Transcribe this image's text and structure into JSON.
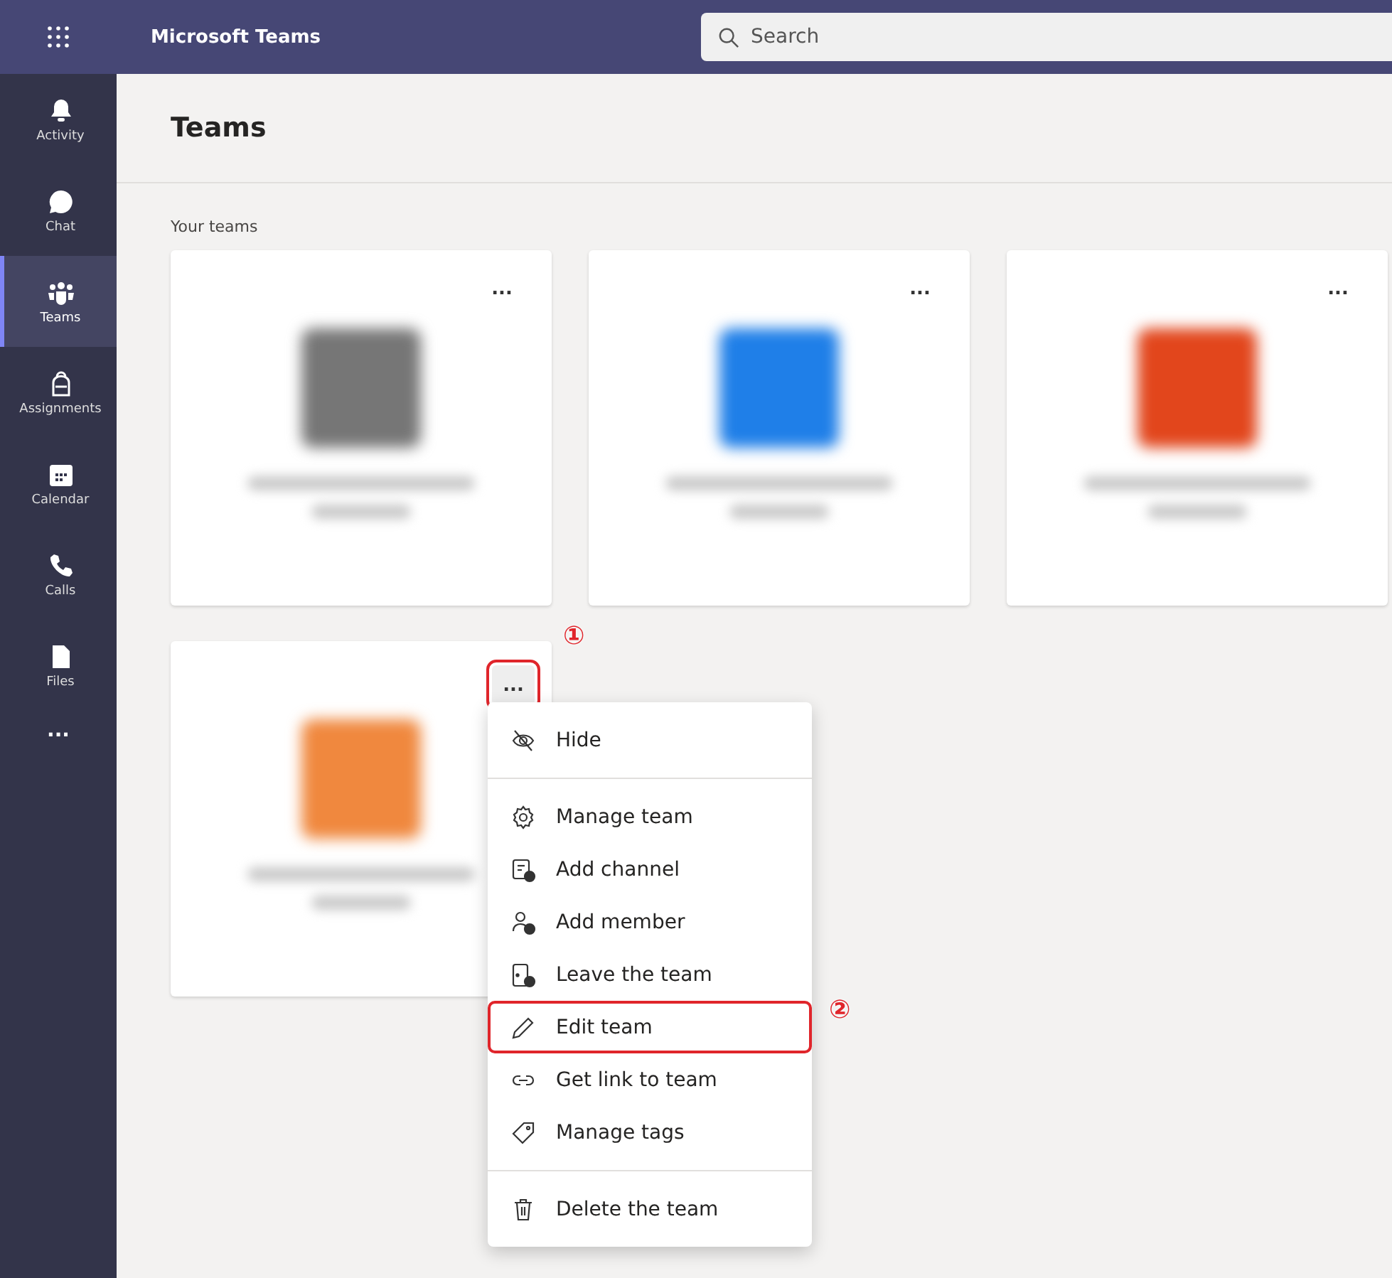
{
  "header": {
    "app_name": "Microsoft Teams",
    "search": {
      "placeholder": "Search"
    }
  },
  "rail": {
    "items": [
      {
        "label": "Activity",
        "selected": false
      },
      {
        "label": "Chat",
        "selected": false
      },
      {
        "label": "Teams",
        "selected": true
      },
      {
        "label": "Assignments",
        "selected": false
      },
      {
        "label": "Calendar",
        "selected": false
      },
      {
        "label": "Calls",
        "selected": false
      },
      {
        "label": "Files",
        "selected": false
      }
    ],
    "more": "..."
  },
  "page": {
    "title": "Teams",
    "section": "Your teams"
  },
  "teams": [
    {
      "color": "#767676",
      "more": "...",
      "menu_open": false
    },
    {
      "color": "#1f7fe8",
      "more": "...",
      "menu_open": false
    },
    {
      "color": "#e2461c",
      "more": "...",
      "menu_open": false
    },
    {
      "color": "#f0883e",
      "more": "...",
      "menu_open": true,
      "annotation": "①"
    }
  ],
  "menu": {
    "groups": [
      [
        {
          "label": "Hide",
          "highlighted": false
        }
      ],
      [
        {
          "label": "Manage team",
          "highlighted": false
        },
        {
          "label": "Add channel",
          "highlighted": false
        },
        {
          "label": "Add member",
          "highlighted": false
        },
        {
          "label": "Leave the team",
          "highlighted": false
        },
        {
          "label": "Edit team",
          "highlighted": true,
          "annotation": "②"
        },
        {
          "label": "Get link to team",
          "highlighted": false
        },
        {
          "label": "Manage tags",
          "highlighted": false
        }
      ],
      [
        {
          "label": "Delete the team",
          "highlighted": false
        }
      ]
    ]
  }
}
